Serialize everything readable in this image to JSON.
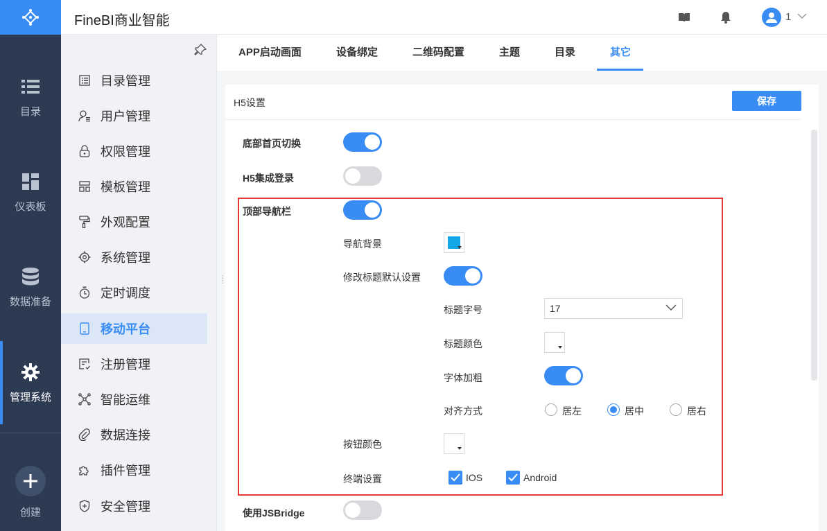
{
  "app": {
    "title": "FineBI商业智能",
    "user": "1"
  },
  "nav": [
    {
      "label": "目录"
    },
    {
      "label": "仪表板"
    },
    {
      "label": "数据准备"
    },
    {
      "label": "管理系统"
    }
  ],
  "nav_create": "创建",
  "submenu": [
    {
      "label": "目录管理"
    },
    {
      "label": "用户管理"
    },
    {
      "label": "权限管理"
    },
    {
      "label": "模板管理"
    },
    {
      "label": "外观配置"
    },
    {
      "label": "系统管理"
    },
    {
      "label": "定时调度"
    },
    {
      "label": "移动平台"
    },
    {
      "label": "注册管理"
    },
    {
      "label": "智能运维"
    },
    {
      "label": "数据连接"
    },
    {
      "label": "插件管理"
    },
    {
      "label": "安全管理"
    }
  ],
  "submenu_active": "移动平台",
  "tabs": [
    {
      "label": "APP启动画面"
    },
    {
      "label": "设备绑定"
    },
    {
      "label": "二维码配置"
    },
    {
      "label": "主题"
    },
    {
      "label": "目录"
    },
    {
      "label": "其它"
    }
  ],
  "active_tab": "其它",
  "panel": {
    "title": "H5设置",
    "save": "保存",
    "bottom_switch": {
      "label": "底部首页切换",
      "on": true
    },
    "h5_login": {
      "label": "H5集成登录",
      "on": false
    },
    "top_nav": {
      "label": "顶部导航栏",
      "on": true
    },
    "nav_bg": {
      "label": "导航背景",
      "color": "#13a6e8"
    },
    "title_default": {
      "label": "修改标题默认设置",
      "on": true
    },
    "font_size": {
      "label": "标题字号",
      "value": "17"
    },
    "title_color": {
      "label": "标题颜色"
    },
    "bold": {
      "label": "字体加粗",
      "on": true
    },
    "align": {
      "label": "对齐方式",
      "options": [
        "居左",
        "居中",
        "居右"
      ],
      "selected": "居中"
    },
    "button_color": {
      "label": "按钮颜色"
    },
    "terminal": {
      "label": "终端设置",
      "options": [
        "IOS",
        "Android"
      ]
    },
    "jsbridge": {
      "label": "使用JSBridge",
      "on": false
    }
  },
  "colors": {
    "accent": "#3a8cf5",
    "nav_bg": "#2c3a52",
    "highlight_box": "#e5383b"
  }
}
